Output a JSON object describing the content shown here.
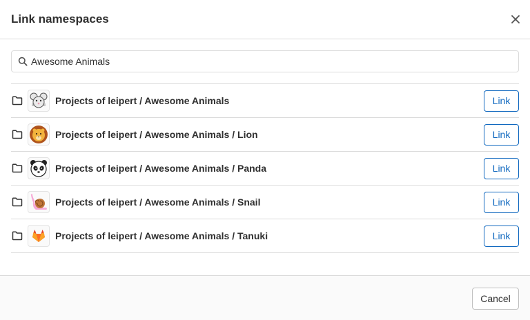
{
  "modal": {
    "title": "Link namespaces",
    "close_icon": "close-icon"
  },
  "search": {
    "value": "Awesome Animals",
    "icon": "search-icon"
  },
  "namespaces": [
    {
      "label": "Projects of leipert / Awesome Animals",
      "avatar": "mouse-avatar",
      "action": "Link"
    },
    {
      "label": "Projects of leipert / Awesome Animals / Lion",
      "avatar": "lion-avatar",
      "action": "Link"
    },
    {
      "label": "Projects of leipert / Awesome Animals / Panda",
      "avatar": "panda-avatar",
      "action": "Link"
    },
    {
      "label": "Projects of leipert / Awesome Animals / Snail",
      "avatar": "snail-avatar",
      "action": "Link"
    },
    {
      "label": "Projects of leipert / Awesome Animals / Tanuki",
      "avatar": "tanuki-avatar",
      "action": "Link"
    }
  ],
  "footer": {
    "cancel_label": "Cancel"
  },
  "colors": {
    "link_blue": "#1068bf",
    "border": "#dbdbdb",
    "text": "#303030",
    "footer_bg": "#fafafa"
  }
}
